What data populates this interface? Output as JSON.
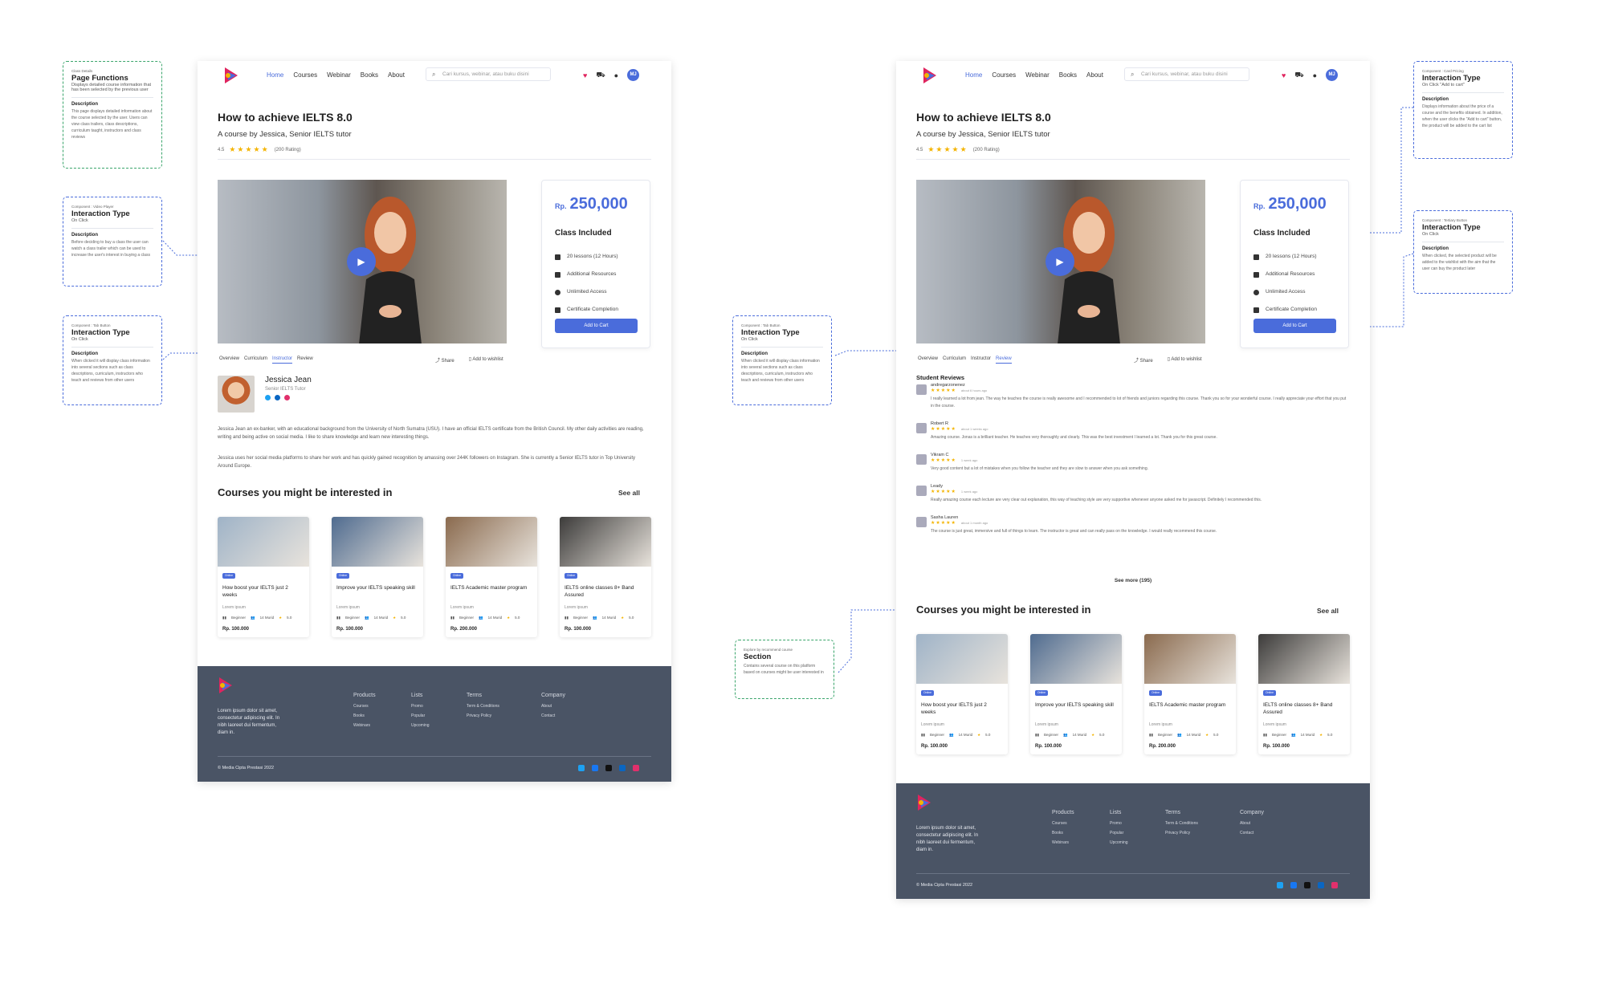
{
  "nav": {
    "links": [
      "Home",
      "Courses",
      "Webinar",
      "Books",
      "About"
    ],
    "search_placeholder": "Cari kursus, webinar, atau buku disini",
    "avatar": "MJ"
  },
  "course": {
    "title": "How to achieve IELTS 8.0",
    "subtitle": "A course by Jessica, Senior IELTS tutor",
    "rating": "4.5",
    "rating_count": "(200 Rating)"
  },
  "price_card": {
    "currency": "Rp.",
    "price": "250,000",
    "heading": "Class Included",
    "items": [
      "20 lessons (12 Hours)",
      "Additional Resources",
      "Unlimited Access",
      "Certificate Completion"
    ],
    "cta": "Add to Cart"
  },
  "tabs": [
    "Overview",
    "Curriculum",
    "Instructor",
    "Review"
  ],
  "actions": {
    "share": "Share",
    "wishlist": "Add to wishlist"
  },
  "instructor": {
    "name": "Jessica Jean",
    "role": "Senior IELTS Tutor",
    "bio1": "Jessica Jean an ex-banker, with an educational background from the University of North Sumatra (USU). I have an official IELTS certificate from the British Council. My other daily activities are reading, writing and being active on social media. I like to share knowledge and learn new interesting things.",
    "bio2": "Jessica uses her social media platforms to share her work and has quickly gained recognition by amassing over 244K followers on Instagram. She is currently a Senior IELTS tutor in Top University Around Europe."
  },
  "reviews": {
    "heading": "Student Reviews",
    "see_more": "See more (195)",
    "items": [
      {
        "name": "andregarzonenez",
        "time": "about 6 hours ago",
        "text": "I really learned a lot from jean. The way he teaches the course is really awesome and I recommended to lot of friends and juniors regarding this course. Thank you so for your wonderful course. I really appreciate your effort that you put in the course."
      },
      {
        "name": "Robert R",
        "time": "about 1 weeks ago",
        "text": "Amazing course. Jonas is a brilliant teacher. He teaches very thoroughly and clearly. This was the best investment I learned a lot. Thank you for this great course."
      },
      {
        "name": "Vikram C",
        "time": "1 week ago",
        "text": "Very good content but a lot of mistakes when you follow the teacher and they are slow to answer when you ask something."
      },
      {
        "name": "Leady",
        "time": "1 week ago",
        "text": "Really amazing course each lecture are very clear out explanation, this way of teaching style are very supportive whenever anyone asked me for javascript. Definitely I recommended this."
      },
      {
        "name": "Sasha Lauren",
        "time": "about 1 month ago",
        "text": "The course is just great, immersive and full of things to learn. The instructor is great and can really pass on the knowledge. I would really recommend this course."
      }
    ]
  },
  "related": {
    "heading": "Courses you might be interested in",
    "see_all": "See all",
    "courses": [
      {
        "badge": "Online",
        "title": "How boost your IELTS just 2 weeks",
        "desc": "Lorem ipsum",
        "level": "Beginner",
        "students": "14 Murid",
        "score": "5.0",
        "price": "Rp. 100.000",
        "color": "#9fb3c7"
      },
      {
        "badge": "Online",
        "title": "Improve your IELTS speaking skill",
        "desc": "Lorem ipsum",
        "level": "Beginner",
        "students": "14 Murid",
        "score": "5.0",
        "price": "Rp. 100.000",
        "color": "#4f6b8f"
      },
      {
        "badge": "Online",
        "title": "IELTS Academic master program",
        "desc": "Lorem ipsum",
        "level": "Beginner",
        "students": "14 Murid",
        "score": "5.0",
        "price": "Rp. 200.000",
        "color": "#8a6a4e"
      },
      {
        "badge": "Online",
        "title": "IELTS online classes 8+ Band Assured",
        "desc": "Lorem ipsum",
        "level": "Beginner",
        "students": "14 Murid",
        "score": "5.0",
        "price": "Rp. 100.000",
        "color": "#3c3b3a"
      }
    ]
  },
  "footer": {
    "desc": "Lorem ipsum dolor sit amet, consectetur adipiscing elit. In nibh laoreet dui fermentum, diam in.",
    "columns": [
      {
        "title": "Products",
        "items": [
          "Courses",
          "Books",
          "Webinars"
        ]
      },
      {
        "title": "Lists",
        "items": [
          "Promo",
          "Popular",
          "Upcoming"
        ]
      },
      {
        "title": "Terms",
        "items": [
          "Term & Conditions",
          "Privacy Policy"
        ]
      },
      {
        "title": "Company",
        "items": [
          "About",
          "Contact"
        ]
      }
    ],
    "copyright": "© Media Cipta Prestasi 2022"
  },
  "notes": {
    "page": {
      "small": "Class Details",
      "title": "Page Functions",
      "sub": "Displays detailed course information that has been selected by the previous user",
      "dhead": "Description",
      "dtext": "This page displays detailed information about the course selected by the user. Users can view class trailers, class descriptions, curriculum taught, instructors and class reviews"
    },
    "video": {
      "small": "Component : Video Player",
      "title": "Interaction Type",
      "sub": "On Click",
      "dhead": "Description",
      "dtext": "Before deciding to buy a class the user can watch a class trailer which can be used to increase the user's interest in buying a class"
    },
    "tab1": {
      "small": "Component : Tab Button",
      "title": "Interaction Type",
      "sub": "On Click",
      "dhead": "Description",
      "dtext": "When clicked it will display class information into several sections such as class descriptions, curriculum, instructors who teach and reviews from other users"
    },
    "tab2": {
      "small": "Component : Tab Button",
      "title": "Interaction Type",
      "sub": "On Click",
      "dhead": "Description",
      "dtext": "When clicked it will display class information into several sections such as class descriptions, curriculum, instructors who teach and reviews from other users"
    },
    "section": {
      "small": "Explore by recommend course",
      "title": "Section",
      "sub": "Contains several course on this platform based on courses might be user interested in"
    },
    "cart": {
      "small": "Component : Card Pricing",
      "title": "Interaction Type",
      "sub": "On Click \"Add to cart\"",
      "dhead": "Description",
      "dtext": "Displays information about the price of a course and the benefits obtained. In addition, when the user clicks the \"Add to cart\" button, the product will be added to the cart list"
    },
    "wish": {
      "small": "Component : Tertiary Button",
      "title": "Interaction Type",
      "sub": "On Click",
      "dhead": "Description",
      "dtext": "When clicked, the selected product will be added to the wishlist with the aim that the user can buy the product later"
    }
  },
  "colors": {
    "accent": "#4a6cdb",
    "footer": "#4a5465",
    "note_green": "#3aa56b"
  }
}
